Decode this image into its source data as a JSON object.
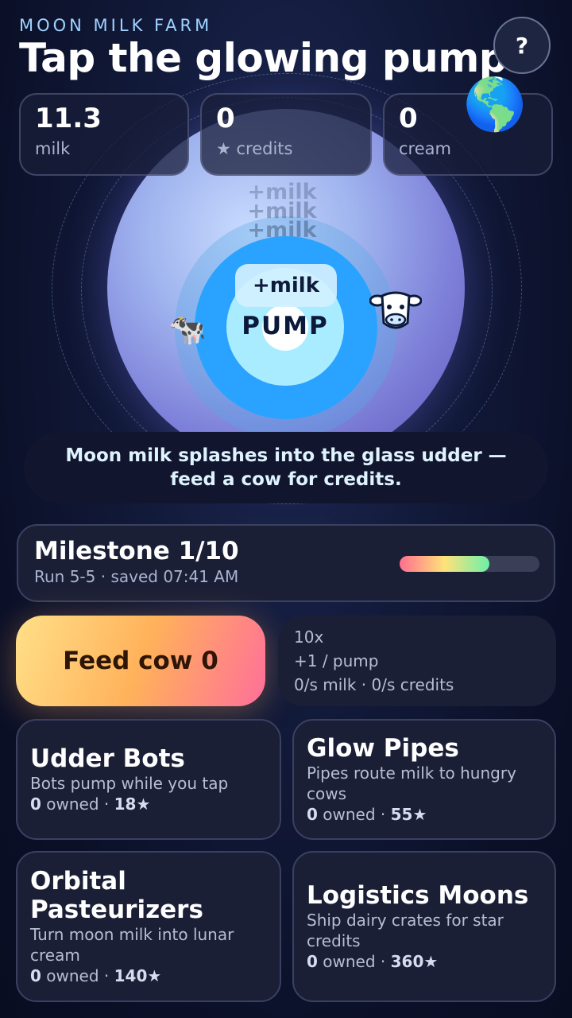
{
  "header": {
    "subtitle": "MOON MILK FARM",
    "title": "Tap the glowing pump",
    "help_label": "?"
  },
  "stats": [
    {
      "value": "11.3",
      "label": "milk"
    },
    {
      "value": "0",
      "label": "★ credits"
    },
    {
      "value": "0",
      "label": "cream"
    }
  ],
  "pump": {
    "label": "PUMP",
    "popup": "+milk"
  },
  "icons": {
    "earth": "earth-globe-icon",
    "cow_left": "cow-icon",
    "cow_right": "cow-face-icon"
  },
  "message": "Moon milk splashes into the glass udder — feed a cow for credits.",
  "milestone": {
    "title": "Milestone 1/10",
    "subtitle": "Run 5-5 · saved 07:41 AM",
    "progress": 0.64
  },
  "feed_button": {
    "label": "Feed cow 0"
  },
  "rates": {
    "multiplier": "10x",
    "per_pump": "+1 / pump",
    "per_second": "0/s milk · 0/s credits"
  },
  "upgrades": [
    {
      "name": "Udder Bots",
      "description": "Bots pump while you tap",
      "owned": "0",
      "owned_label": "owned",
      "cost": "18★"
    },
    {
      "name": "Glow Pipes",
      "description": "Pipes route milk to hungry cows",
      "owned": "0",
      "owned_label": "owned",
      "cost": "55★"
    },
    {
      "name": "Orbital Pasteurizers",
      "description": "Turn moon milk into lunar cream",
      "owned": "0",
      "owned_label": "owned",
      "cost": "140★"
    },
    {
      "name": "Logistics Moons",
      "description": "Ship dairy crates for star credits",
      "owned": "0",
      "owned_label": "owned",
      "cost": "360★"
    }
  ],
  "colors": {
    "accent": "#29a3ff",
    "feed_start": "#ffe089",
    "feed_end": "#ff6f9a"
  }
}
